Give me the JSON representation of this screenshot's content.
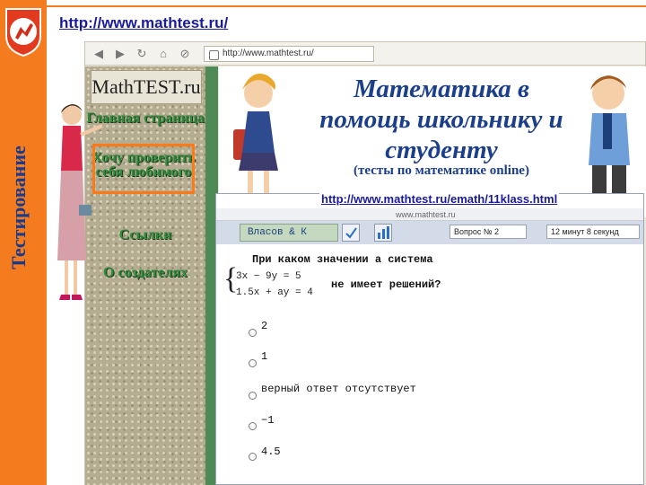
{
  "slide": {
    "vertical_title": "Тестирование",
    "top_url": "http://www.mathtest.ru/",
    "accent_color": "#f47c1f"
  },
  "browser": {
    "address": "http://www.mathtest.ru/",
    "logo": "MathTEST.ru",
    "nav": [
      "Главная страница",
      "Хочу проверить себя любимого",
      "Ссылки",
      "О создателях"
    ],
    "heading": "Математика в помощь школьнику и студенту",
    "subheading": "(тесты по математике online)"
  },
  "test": {
    "url": "http://www.mathtest.ru/emath/11klass.html",
    "toolbar_address": "www.mathtest.ru",
    "student": "Власов & К",
    "question_no": "Вопрос № 2",
    "timer": "12 минут 8 секунд",
    "question_line1": "При каком значении a система",
    "question_line2": "не имеет решений?",
    "eq1": "3x − 9y = 5",
    "eq2": "1.5x + ay = 4",
    "answers": [
      "2",
      "1",
      "верный ответ отсутствует",
      "−1",
      "4.5"
    ]
  }
}
